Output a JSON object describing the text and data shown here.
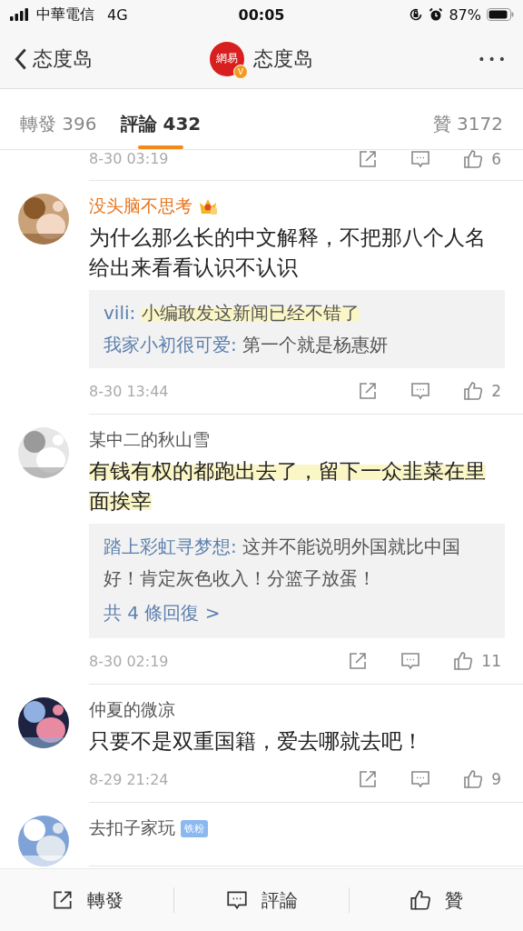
{
  "status_bar": {
    "carrier": "中華電信",
    "network": "4G",
    "time": "00:05",
    "battery": "87%"
  },
  "nav": {
    "back_label": "态度岛",
    "logo_text": "網易",
    "verified_mark": "V",
    "title": "态度岛",
    "more": "•••"
  },
  "tabs": [
    {
      "label": "轉發 396",
      "selected": false
    },
    {
      "label": "評論 432",
      "selected": true
    },
    {
      "label": "贊 3172",
      "selected": false
    }
  ],
  "top_partial": {
    "time": "8-30 03:19",
    "likes": "6"
  },
  "comments": [
    {
      "user": "没头脑不思考",
      "vip": true,
      "text": "为什么那么长的中文解释，不把那八个人名给出来看看认识不认识",
      "highlighted": false,
      "replies": [
        {
          "user": "vili:",
          "text": "小编敢发这新闻已经不错了",
          "highlighted": true
        },
        {
          "user": "我家小初很可爱:",
          "text": "第一个就是杨惠妍",
          "highlighted": false
        }
      ],
      "time": "8-30 13:44",
      "likes": "2"
    },
    {
      "user": "某中二的秋山雪",
      "vip": false,
      "text": "有钱有权的都跑出去了，留下一众韭菜在里面挨宰",
      "highlighted": true,
      "replies": [
        {
          "user": "踏上彩虹寻梦想:",
          "text": "这并不能说明外国就比中国好！肯定灰色收入！分篮子放蛋！",
          "highlighted": false
        }
      ],
      "more_replies": "共 4 條回復 >",
      "time": "8-30 02:19",
      "likes": "11"
    },
    {
      "user": "仲夏的微凉",
      "vip": false,
      "text": "只要不是双重国籍，爱去哪就去吧！",
      "highlighted": false,
      "time": "8-29 21:24",
      "likes": "9"
    },
    {
      "user": "去扣子家玩",
      "vip": false,
      "badge": "铁粉"
    }
  ],
  "bottom_bar": [
    {
      "kind": "share",
      "label": "轉發"
    },
    {
      "kind": "comment",
      "label": "評論"
    },
    {
      "kind": "like",
      "label": "贊"
    }
  ]
}
